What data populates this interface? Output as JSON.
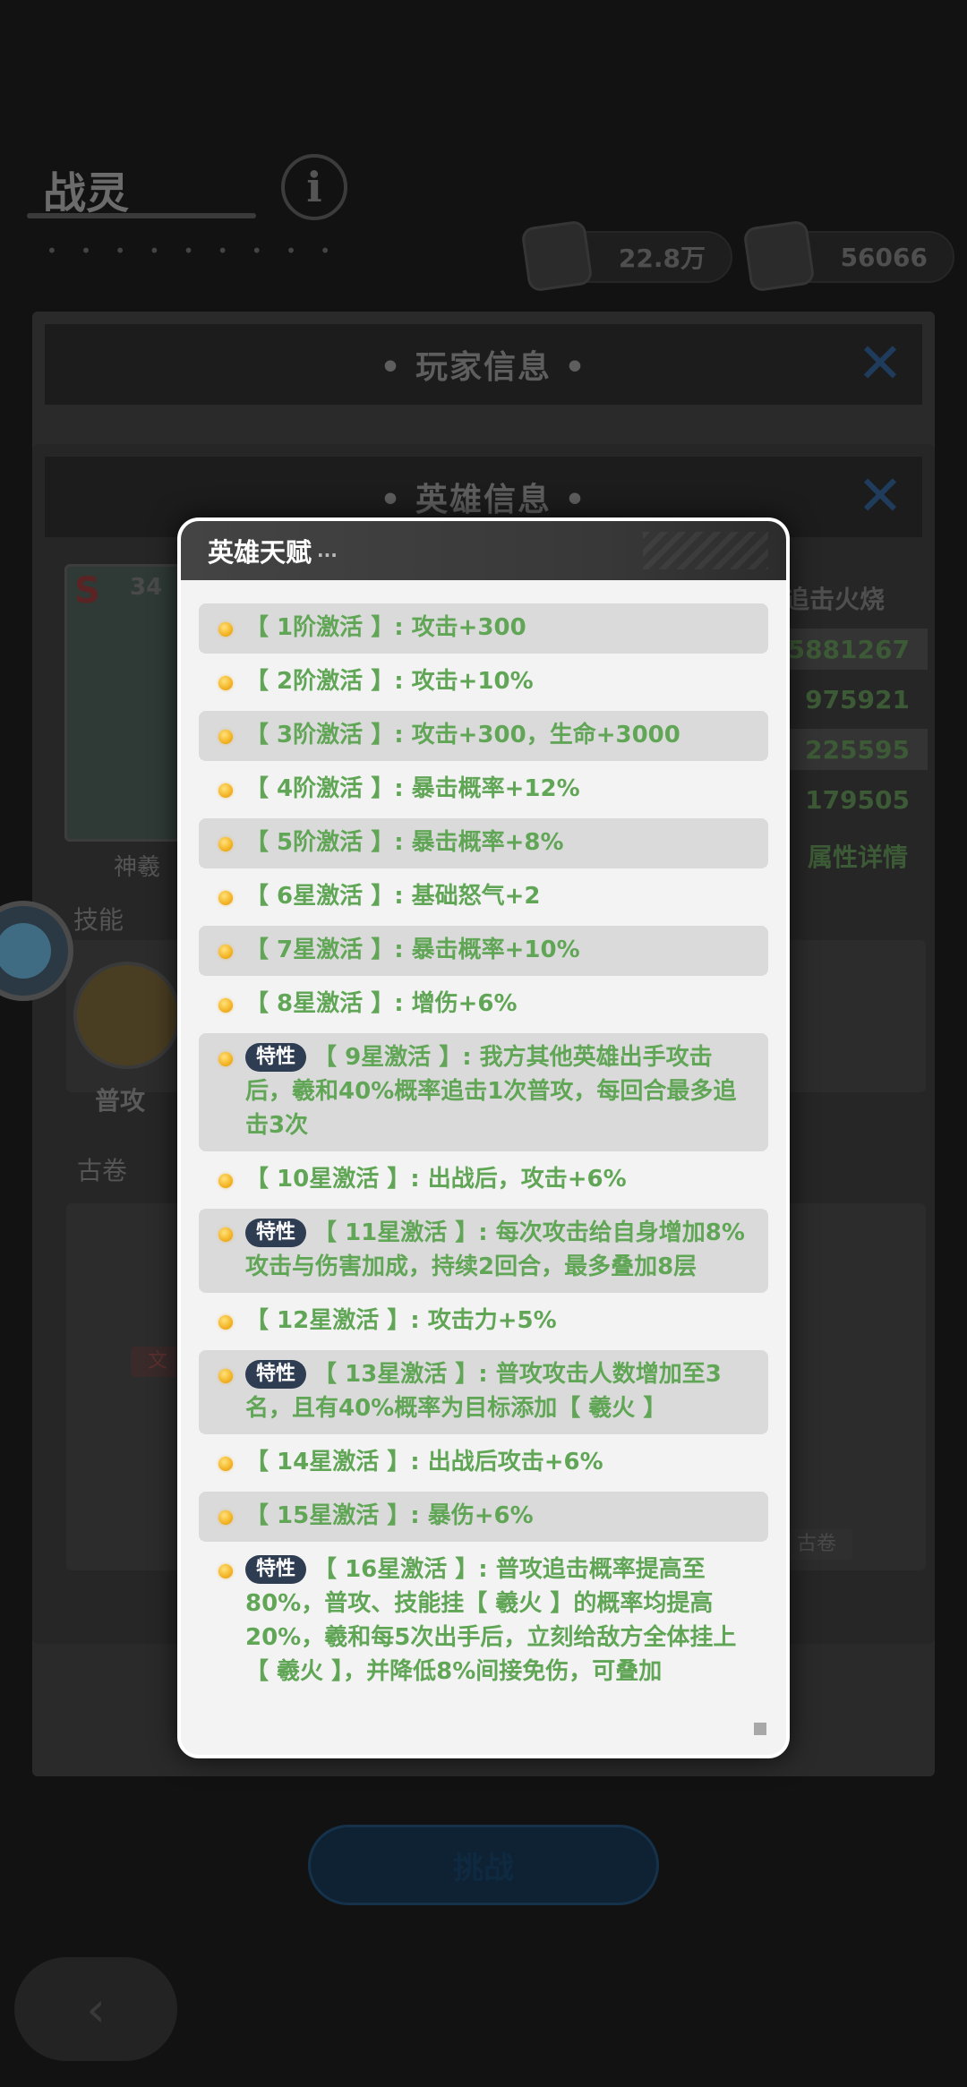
{
  "page": {
    "title": "战灵",
    "title_subtext": "• • • • • • • • •",
    "info_icon": "info-icon"
  },
  "resources": [
    {
      "icon": "star-upgrade-icon",
      "value": "22.8万"
    },
    {
      "icon": "book-upgrade-icon",
      "value": "56066"
    }
  ],
  "player_panel": {
    "title": "• 玩家信息 •"
  },
  "hero_panel": {
    "title": "• 英雄信息 •",
    "hero_rank": "S",
    "hero_level": "34",
    "hero_name": "神羲",
    "passive_label": "追击火烧",
    "stats": [
      "5881267",
      "975921",
      "225595",
      "179505"
    ],
    "attr_details_label": "属性详情",
    "skills_label": "技能",
    "skill_name": "普攻",
    "scroll_label": "古卷",
    "scroll_left_tag": "文",
    "scroll_right_tag": "古卷"
  },
  "challenge_button": "挑战",
  "dialog": {
    "title": "英雄天赋",
    "title_dots": "...",
    "talents": [
      {
        "text": "【 1阶激活 】: 攻击+300"
      },
      {
        "text": "【 2阶激活 】: 攻击+10%"
      },
      {
        "text": "【 3阶激活 】: 攻击+300，生命+3000"
      },
      {
        "text": "【 4阶激活 】: 暴击概率+12%"
      },
      {
        "text": "【 5阶激活 】: 暴击概率+8%"
      },
      {
        "text": "【 6星激活 】: 基础怒气+2"
      },
      {
        "text": "【 7星激活 】: 暴击概率+10%"
      },
      {
        "text": "【 8星激活 】: 增伤+6%"
      },
      {
        "tag": "特性",
        "text": "【 9星激活 】: 我方其他英雄出手攻击后，羲和40%概率追击1次普攻，每回合最多追击3次"
      },
      {
        "text": "【 10星激活 】: 出战后，攻击+6%"
      },
      {
        "tag": "特性",
        "text": "【 11星激活 】: 每次攻击给自身增加8%攻击与伤害加成，持续2回合，最多叠加8层"
      },
      {
        "text": "【 12星激活 】: 攻击力+5%"
      },
      {
        "tag": "特性",
        "text": "【 13星激活 】: 普攻攻击人数增加至3名，且有40%概率为目标添加【 羲火 】"
      },
      {
        "text": "【 14星激活 】: 出战后攻击+6%"
      },
      {
        "text": "【 15星激活 】: 暴伤+6%"
      },
      {
        "tag": "特性",
        "text": "【 16星激活 】: 普攻追击概率提高至80%，普攻、技能挂【 羲火 】的概率均提高20%，羲和每5次出手后，立刻给敌方全体挂上【 羲火 】，并降低8%间接免伤，可叠加"
      }
    ]
  },
  "colors": {
    "talent_text": "#61a656",
    "tag_bg": "#2f3d52",
    "close_icon": "#1f3c5c"
  }
}
